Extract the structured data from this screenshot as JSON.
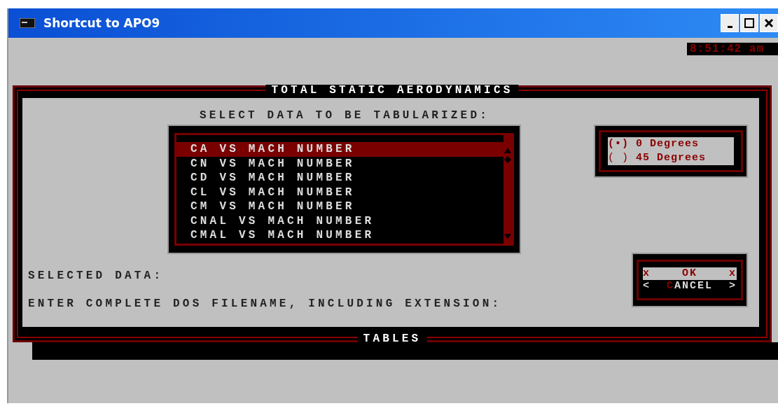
{
  "window": {
    "title": "Shortcut to APO9"
  },
  "clock": "8:51:42 am",
  "dialog": {
    "title": "TOTAL STATIC AERODYNAMICS",
    "footer": "TABLES",
    "prompt": "SELECT DATA TO BE TABULARIZED:",
    "items": [
      {
        "label": "CA VS MACH NUMBER",
        "selected": true
      },
      {
        "label": "CN VS MACH NUMBER",
        "selected": false
      },
      {
        "label": "CD VS MACH NUMBER",
        "selected": false
      },
      {
        "label": "CL VS MACH NUMBER",
        "selected": false
      },
      {
        "label": "CM VS MACH NUMBER",
        "selected": false
      },
      {
        "label": "CNAL VS MACH NUMBER",
        "selected": false
      },
      {
        "label": "CMAL VS MACH NUMBER",
        "selected": false
      }
    ],
    "radios": [
      {
        "mark": "(•)",
        "label": "0 Degrees",
        "selected": true
      },
      {
        "mark": "( )",
        "label": "45 Degrees",
        "selected": false
      }
    ],
    "labels": [
      "SELECTED DATA:",
      "ENTER COMPLETE DOS FILENAME, INCLUDING EXTENSION:"
    ],
    "buttons": [
      {
        "left": "x",
        "label": "OK",
        "right": "x",
        "selected": true
      },
      {
        "left": "<",
        "hotkey": "C",
        "label": "ANCEL",
        "right": ">",
        "selected": false
      }
    ]
  }
}
